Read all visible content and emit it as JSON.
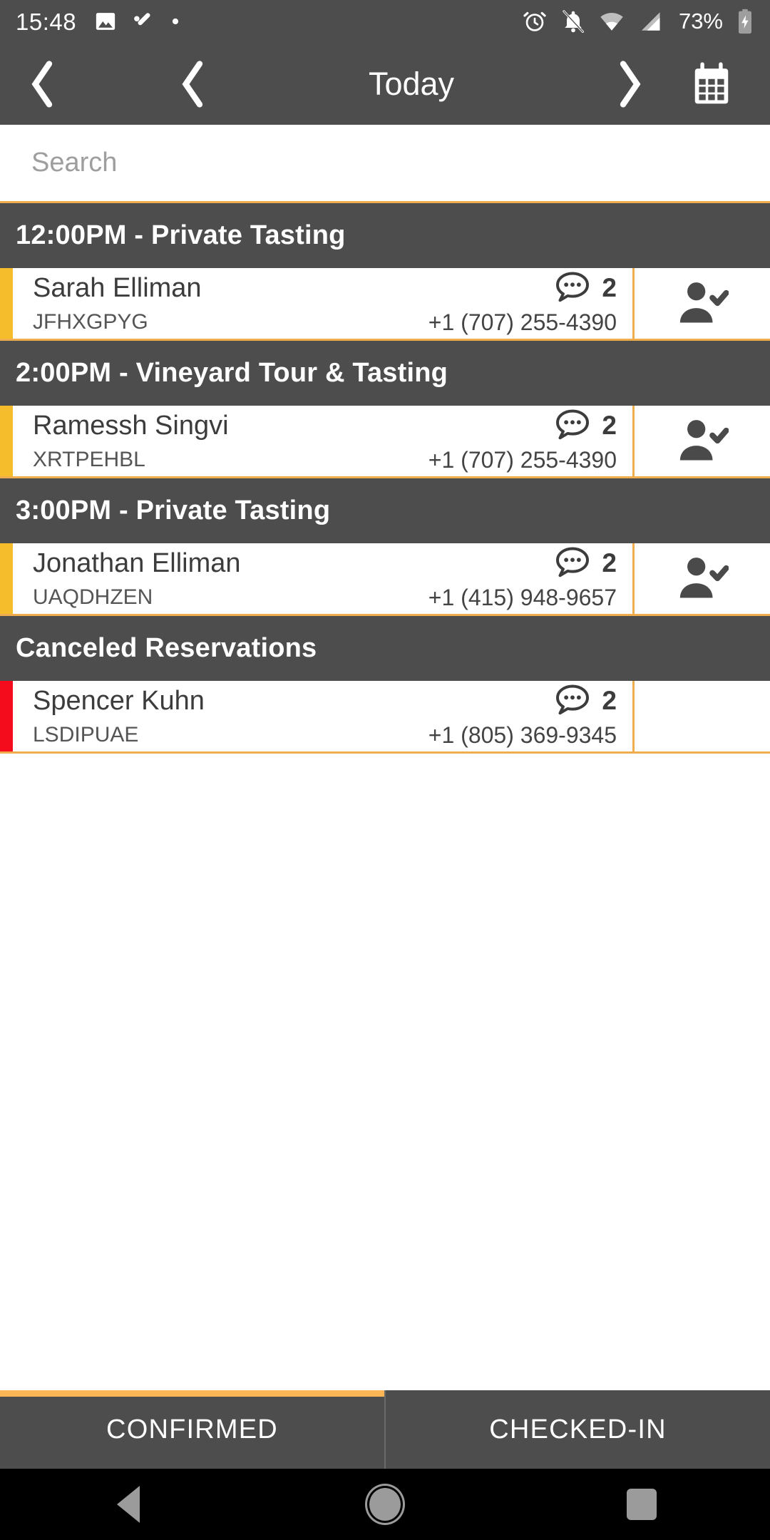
{
  "status_bar": {
    "time": "15:48",
    "battery_percent": "73%",
    "left_icons": [
      "image-icon",
      "edit-check-icon",
      "dot-icon"
    ],
    "right_icons": [
      "alarm-icon",
      "notifications-off-icon",
      "wifi-icon",
      "signal-icon",
      "battery-charging-icon"
    ]
  },
  "toolbar": {
    "back_label": "back-chevron",
    "prev_label": "previous-day-chevron",
    "title": "Today",
    "next_label": "next-day-chevron",
    "calendar_label": "calendar-picker"
  },
  "search": {
    "value": "",
    "placeholder": "Search"
  },
  "sections": [
    {
      "title": "12:00PM - Private Tasting",
      "type": "confirmed",
      "rows": [
        {
          "name": "Sarah Elliman",
          "code": "JFHXGPYG",
          "phone": "+1 (707) 255-4390",
          "guests": "2",
          "accent": "confirmed",
          "action": "check-in"
        }
      ]
    },
    {
      "title": "2:00PM - Vineyard Tour & Tasting",
      "type": "confirmed",
      "rows": [
        {
          "name": "Ramessh Singvi",
          "code": "XRTPEHBL",
          "phone": "+1 (707) 255-4390",
          "guests": "2",
          "accent": "confirmed",
          "action": "check-in"
        }
      ]
    },
    {
      "title": "3:00PM - Private Tasting",
      "type": "confirmed",
      "rows": [
        {
          "name": "Jonathan Elliman",
          "code": "UAQDHZEN",
          "phone": "+1 (415) 948-9657",
          "guests": "2",
          "accent": "confirmed",
          "action": "check-in"
        }
      ]
    },
    {
      "title": "Canceled Reservations",
      "type": "canceled",
      "rows": [
        {
          "name": "Spencer Kuhn",
          "code": "LSDIPUAE",
          "phone": "+1 (805) 369-9345",
          "guests": "2",
          "accent": "canceled",
          "action": "none"
        }
      ]
    }
  ],
  "tabs": [
    {
      "label": "CONFIRMED",
      "active": true
    },
    {
      "label": "CHECKED-IN",
      "active": false
    }
  ],
  "nav_bar": {
    "back": "back-triangle-icon",
    "home": "home-circle-icon",
    "recents": "recents-square-icon"
  },
  "colors": {
    "chrome": "#4d4d4d",
    "accent_confirmed": "#f5bc2b",
    "accent_canceled": "#f40b1c",
    "divider": "#f0ad4e",
    "tab_indicator": "#fcb655"
  }
}
